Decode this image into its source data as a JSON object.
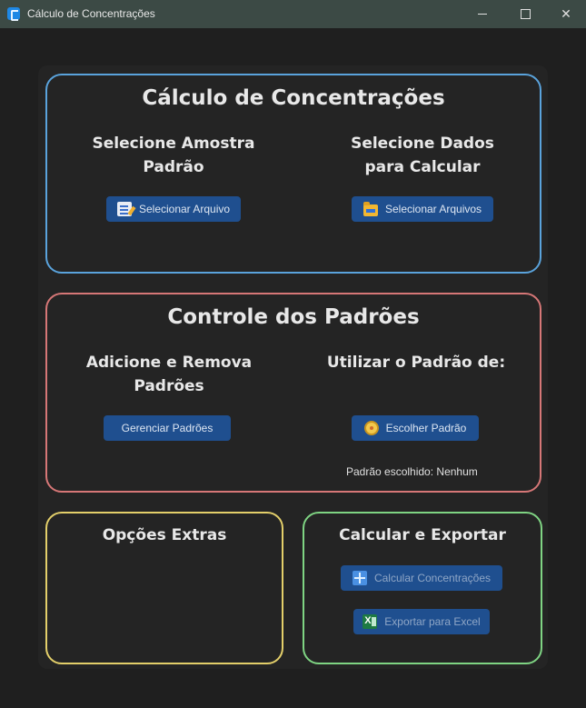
{
  "window": {
    "title": "Cálculo de Concentrações",
    "icon": "app-icon",
    "controls": {
      "minimize": "–",
      "maximize": "□",
      "close": "✕"
    }
  },
  "calc_section": {
    "title": "Cálculo de Concentrações",
    "left_heading_line1": "Selecione Amostra",
    "left_heading_line2": "Padrão",
    "left_button": {
      "label": "Selecionar Arquivo",
      "icon": "notepad-icon"
    },
    "right_heading_line1": "Selecione Dados",
    "right_heading_line2": "para Calcular",
    "right_button": {
      "label": "Selecionar Arquivos",
      "icon": "folder-icon"
    }
  },
  "control_section": {
    "title": "Controle dos Padrões",
    "left_heading_line1": "Adicione e Remova",
    "left_heading_line2": "Padrões",
    "left_button": {
      "label": "Gerenciar Padrões"
    },
    "right_heading": "Utilizar o Padrão de:",
    "right_button": {
      "label": "Escolher Padrão",
      "icon": "medal-icon"
    },
    "chosen_status": "Padrão escolhido: Nenhum"
  },
  "extras_section": {
    "title": "Opções Extras"
  },
  "export_section": {
    "title": "Calcular e Exportar",
    "calculate_button": {
      "label": "Calcular Concentrações",
      "icon": "calculator-icon",
      "state": "disabled"
    },
    "export_button": {
      "label": "Exportar para Excel",
      "icon": "excel-icon",
      "state": "disabled"
    }
  },
  "colors": {
    "calc_border": "#5aa3dc",
    "control_border": "#d67777",
    "extras_border": "#e3cf6a",
    "export_border": "#7fd483",
    "button_bg": "#1f4f8f"
  }
}
